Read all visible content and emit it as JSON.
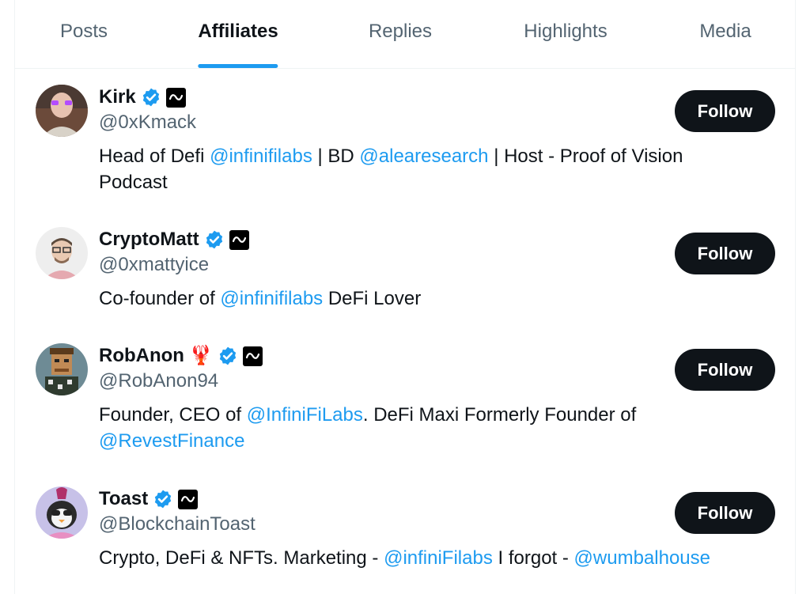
{
  "tabs": [
    {
      "label": "Posts",
      "active": false
    },
    {
      "label": "Affiliates",
      "active": true
    },
    {
      "label": "Replies",
      "active": false
    },
    {
      "label": "Highlights",
      "active": false
    },
    {
      "label": "Media",
      "active": false
    }
  ],
  "accent_color": "#1d9bf0",
  "affiliates": [
    {
      "name": "Kirk",
      "emoji": "",
      "handle": "@0xKmack",
      "bio": [
        {
          "text": "Head of Defi "
        },
        {
          "text": "@infinifilabs",
          "mention": true
        },
        {
          "text": " | BD "
        },
        {
          "text": "@alearesearch",
          "mention": true
        },
        {
          "text": " | Host - Proof of Vision Podcast"
        }
      ],
      "follow_label": "Follow"
    },
    {
      "name": "CryptoMatt",
      "emoji": "",
      "handle": "@0xmattyice",
      "bio": [
        {
          "text": "Co-founder of "
        },
        {
          "text": "@infinifilabs",
          "mention": true
        },
        {
          "text": " DeFi Lover"
        }
      ],
      "follow_label": "Follow"
    },
    {
      "name": "RobAnon",
      "emoji": "🦞",
      "handle": "@RobAnon94",
      "bio": [
        {
          "text": "Founder, CEO of "
        },
        {
          "text": "@InfiniFiLabs",
          "mention": true
        },
        {
          "text": ". DeFi Maxi Formerly Founder of "
        },
        {
          "text": "@RevestFinance",
          "mention": true
        }
      ],
      "follow_label": "Follow"
    },
    {
      "name": "Toast",
      "emoji": "",
      "handle": "@BlockchainToast",
      "bio": [
        {
          "text": "Crypto, DeFi & NFTs. Marketing - "
        },
        {
          "text": "@infiniFilabs",
          "mention": true
        },
        {
          "text": " I forgot - "
        },
        {
          "text": "@wumbalhouse",
          "mention": true
        }
      ],
      "follow_label": "Follow"
    }
  ]
}
